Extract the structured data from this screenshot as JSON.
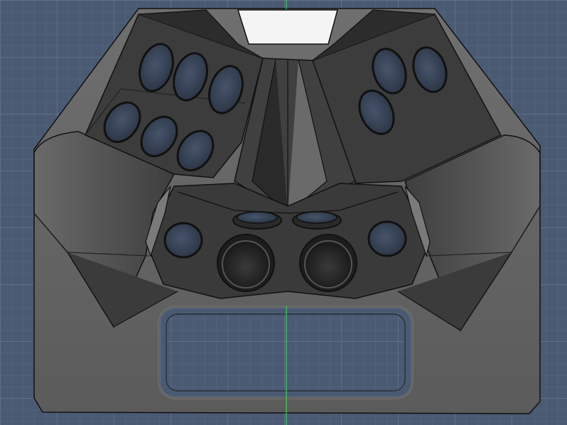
{
  "viewport": {
    "view": "cad-3d-model-viewport",
    "background_color": "#4a5a73",
    "grid_minor_color": "#5b6b84",
    "grid_major_color": "#6d7d95",
    "axis_color": "#3ccf5a"
  },
  "model": {
    "edge_color": "#111111",
    "face_dark": "#2e2e2e",
    "face_mid": "#474747",
    "face_light": "#8a8a8a",
    "base_plate": "#6a6a6a",
    "cutout_fill": "#1c1c1c"
  }
}
